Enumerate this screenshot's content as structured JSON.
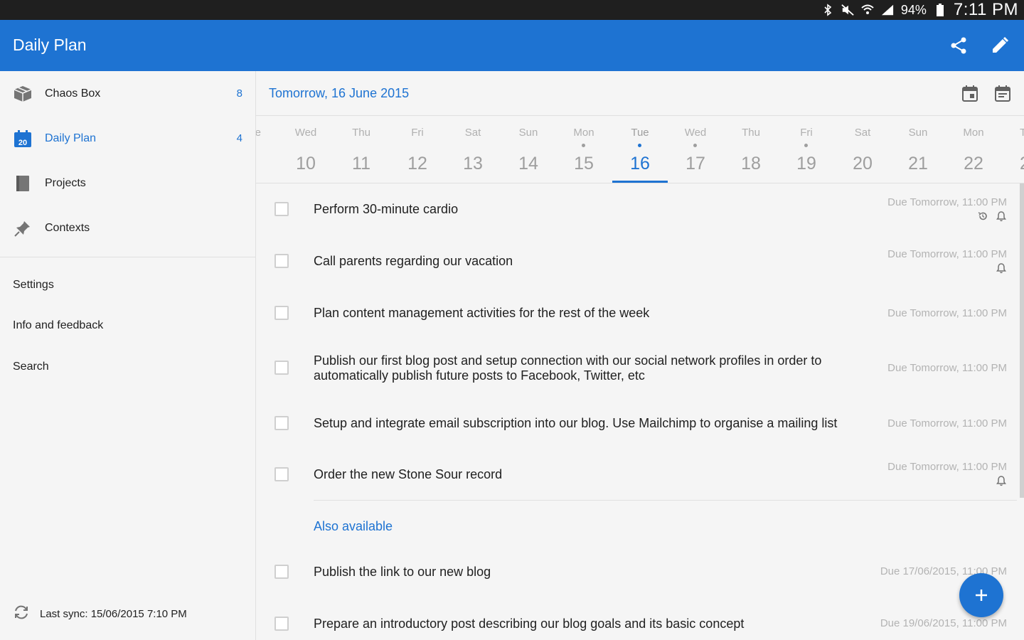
{
  "status_bar": {
    "battery_percent": "94%",
    "time": "7:11 PM",
    "icons": [
      "bluetooth-icon",
      "mute-icon",
      "wifi-icon",
      "signal-icon",
      "battery-icon"
    ]
  },
  "app_bar": {
    "title": "Daily Plan",
    "actions": [
      "share-icon",
      "edit-icon"
    ],
    "color": "#1e73d2"
  },
  "sidebar": {
    "items": [
      {
        "label": "Chaos Box",
        "count": "8",
        "icon": "box-icon"
      },
      {
        "label": "Daily Plan",
        "count": "4",
        "icon": "calendar-icon",
        "icon_text": "20",
        "active": true
      },
      {
        "label": "Projects",
        "count": "",
        "icon": "book-icon"
      },
      {
        "label": "Contexts",
        "count": "",
        "icon": "pin-icon"
      }
    ],
    "menu": [
      {
        "label": "Settings"
      },
      {
        "label": "Info and feedback"
      },
      {
        "label": "Search"
      }
    ],
    "sync": "Last sync: 15/06/2015 7:10 PM"
  },
  "main": {
    "date_title": "Tomorrow, 16 June 2015",
    "days": [
      {
        "dow": "Wed",
        "num": "10"
      },
      {
        "dow": "Thu",
        "num": "11"
      },
      {
        "dow": "Fri",
        "num": "12"
      },
      {
        "dow": "Sat",
        "num": "13"
      },
      {
        "dow": "Sun",
        "num": "14"
      },
      {
        "dow": "Mon",
        "num": "15",
        "dot": true
      },
      {
        "dow": "Tue",
        "num": "16",
        "dot": true,
        "selected": true
      },
      {
        "dow": "Wed",
        "num": "17",
        "dot": true
      },
      {
        "dow": "Thu",
        "num": "18"
      },
      {
        "dow": "Fri",
        "num": "19",
        "dot": true
      },
      {
        "dow": "Sat",
        "num": "20"
      },
      {
        "dow": "Sun",
        "num": "21"
      },
      {
        "dow": "Mon",
        "num": "22"
      }
    ],
    "tasks": [
      {
        "title": "Perform 30-minute cardio",
        "due": "Due Tomorrow, 11:00 PM",
        "icons": [
          "repeat-icon",
          "bell-icon"
        ]
      },
      {
        "title": "Call parents regarding our vacation",
        "due": "Due Tomorrow, 11:00 PM",
        "icons": [
          "bell-icon"
        ]
      },
      {
        "title": "Plan content management activities for the rest of the week",
        "due": "Due Tomorrow, 11:00 PM",
        "icons": []
      },
      {
        "title": "Publish our first blog post and setup connection with our social network profiles in order to automatically publish future posts to Facebook, Twitter, etc",
        "due": "Due Tomorrow, 11:00 PM",
        "icons": []
      },
      {
        "title": "Setup and integrate email subscription into our blog. Use Mailchimp to organise a mailing list",
        "due": "Due Tomorrow, 11:00 PM",
        "icons": []
      },
      {
        "title": "Order the new Stone Sour record",
        "due": "Due Tomorrow, 11:00 PM",
        "icons": [
          "bell-icon"
        ]
      }
    ],
    "also_available_label": "Also available",
    "also_tasks": [
      {
        "title": "Publish the link to our new blog",
        "due": "Due 17/06/2015, 11:00 PM"
      },
      {
        "title": "Prepare an introductory post describing our blog goals and its basic concept",
        "due": "Due 19/06/2015, 11:00 PM"
      }
    ]
  },
  "fab": {
    "icon": "plus-icon"
  }
}
